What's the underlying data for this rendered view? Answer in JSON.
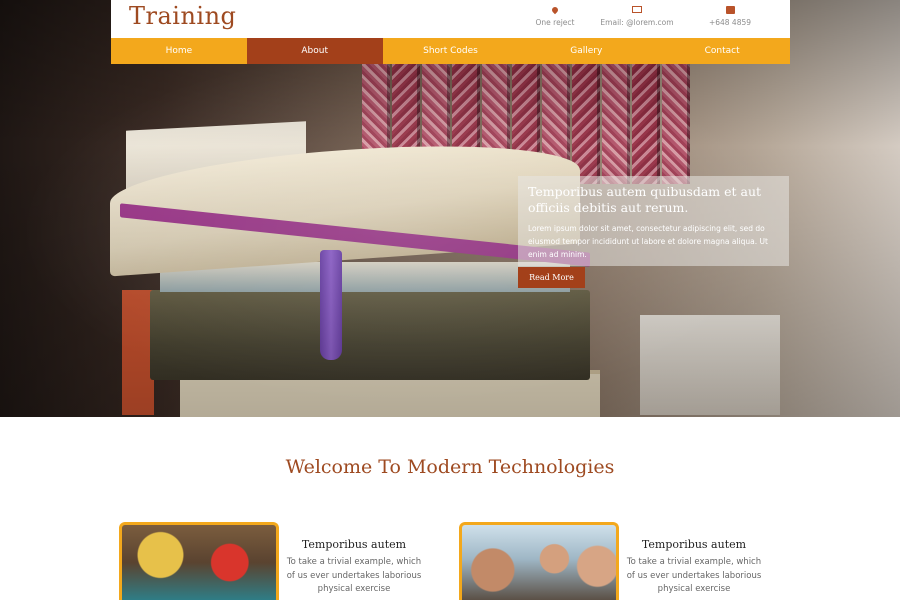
{
  "header": {
    "logo": "Training",
    "contacts": [
      {
        "icon": "location-pin-icon",
        "text": "One reject"
      },
      {
        "icon": "mail-icon",
        "text": "Email: @lorem.com"
      },
      {
        "icon": "phone-icon",
        "text": "+648 4859"
      }
    ]
  },
  "nav": {
    "items": [
      "Home",
      "About",
      "Short Codes",
      "Gallery",
      "Contact"
    ],
    "active": "About"
  },
  "hero": {
    "caption_title": "Temporibus autem quibusdam et aut officiis debitis aut rerum.",
    "caption_text": "Lorem ipsum dolor sit amet, consectetur adipiscing elit, sed do eiusmod tempor incididunt ut labore et dolore magna aliqua. Ut enim ad minim.",
    "button_label": "Read More"
  },
  "welcome": {
    "heading": "Welcome To Modern Technologies"
  },
  "features": [
    {
      "title": "Temporibus autem",
      "desc": "To take a trivial example, which of us ever undertakes laborious physical exercise"
    },
    {
      "title": "Temporibus autem",
      "desc": "To take a trivial example, which of us ever undertakes laborious physical exercise"
    }
  ],
  "colors": {
    "brand": "#9e4a21",
    "nav_bg": "#f3a81c",
    "nav_active": "#a3401a"
  }
}
